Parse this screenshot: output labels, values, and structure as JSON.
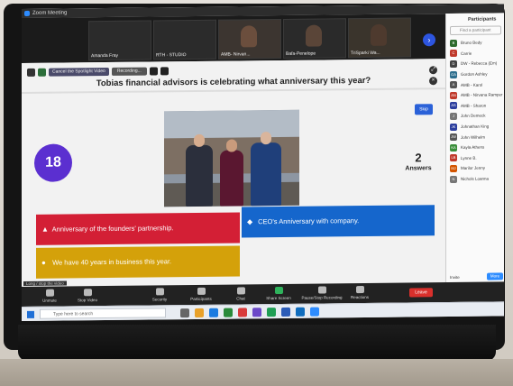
{
  "window": {
    "title": "Zoom Meeting"
  },
  "thumbnails": [
    {
      "name": "Amanda Fray"
    },
    {
      "name": "RTH - STUDIO"
    },
    {
      "name": "AMB- Nirvan..."
    },
    {
      "name": "Bafa-Penelope"
    },
    {
      "name": "TriSparki Wa..."
    }
  ],
  "top_controls": {
    "spotlight_label": "Cancel the Spotlight Video",
    "recording_label": "Recording..."
  },
  "quiz": {
    "question": "Tobias financial advisors is celebrating what anniversary this year?",
    "timer": "18",
    "skip_label": "Skip",
    "answer_count": "2",
    "answer_label": "Answers",
    "answers": [
      {
        "symbol": "▲",
        "text": "Anniversary of the founders' partnership.",
        "color": "#d31f35"
      },
      {
        "symbol": "◆",
        "text": "CEO's Anniversary with company.",
        "color": "#1566cc"
      },
      {
        "symbol": "●",
        "text": "We have 40 years in business this year.",
        "color": "#d4a10a"
      }
    ]
  },
  "participants_panel": {
    "title": "Participants",
    "search_placeholder": "Find a participant",
    "participants": [
      {
        "initials": "B",
        "name": "Bruno Bedy",
        "color": "#2d6a2d"
      },
      {
        "initials": "C",
        "name": "Carrie",
        "color": "#c0392b"
      },
      {
        "initials": "D",
        "name": "DW - Rebecca (Em)",
        "color": "#444"
      },
      {
        "initials": "GA",
        "name": "Gordon Ashley",
        "color": "#2e6f8e"
      },
      {
        "initials": "A",
        "name": "AMB - Karol",
        "color": "#555"
      },
      {
        "initials": "AN",
        "name": "AMB - Nirvana Ramper",
        "color": "#c0392b"
      },
      {
        "initials": "AS",
        "name": "AMB - Sharon",
        "color": "#2c3e9e"
      },
      {
        "initials": "J",
        "name": "John Demeck",
        "color": "#777"
      },
      {
        "initials": "JK",
        "name": "Johnathan King",
        "color": "#2c3e9e"
      },
      {
        "initials": "JW",
        "name": "John Wilhelm",
        "color": "#555"
      },
      {
        "initials": "KA",
        "name": "Kayla Athens",
        "color": "#3a8e3a"
      },
      {
        "initials": "LB",
        "name": "Lynne B.",
        "color": "#c0392b"
      },
      {
        "initials": "MJ",
        "name": "Marilor Jenny",
        "color": "#d35400"
      },
      {
        "initials": "N",
        "name": "Nichols Loanna",
        "color": "#777"
      }
    ],
    "invite_label": "Invite",
    "more_label": "More"
  },
  "toolbar": {
    "items": [
      {
        "label": "Unmute"
      },
      {
        "label": "Stop Video"
      },
      {
        "label": "Security"
      },
      {
        "label": "Participants"
      },
      {
        "label": "Chat"
      },
      {
        "label": "Share Screen"
      },
      {
        "label": "Pause/Stop Recording"
      },
      {
        "label": "Reactions"
      }
    ],
    "leave_label": "Leave",
    "tip_label": "Long / stop the video"
  },
  "taskbar": {
    "search_placeholder": "Type here to search"
  }
}
